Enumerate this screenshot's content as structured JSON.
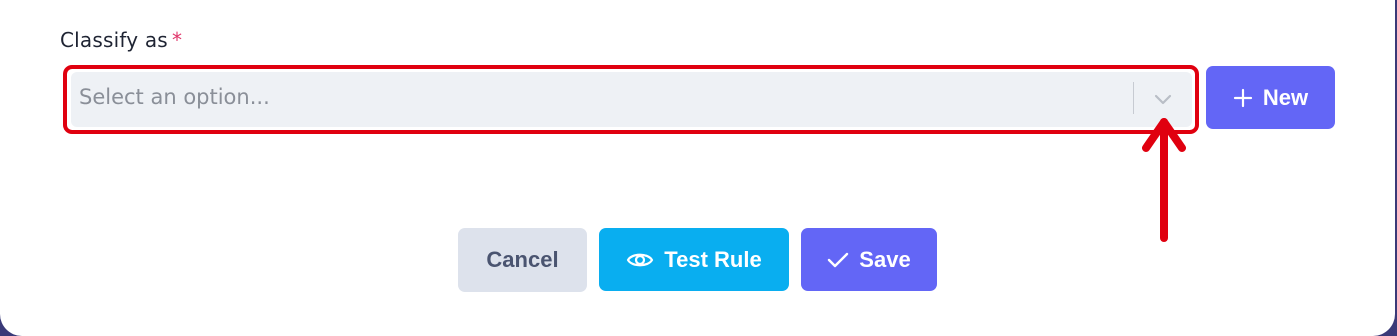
{
  "form": {
    "classify_label": "Classify as",
    "required_marker": "*",
    "select": {
      "placeholder": "Select an option...",
      "value": ""
    },
    "new_button_label": "New"
  },
  "actions": {
    "cancel_label": "Cancel",
    "test_rule_label": "Test Rule",
    "save_label": "Save"
  },
  "icons": {
    "chevron": "chevron-down-icon",
    "plus": "plus-icon",
    "eye": "eye-icon",
    "check": "check-icon"
  },
  "colors": {
    "primary": "#6366f6",
    "test_button": "#09aef0",
    "cancel_button": "#dde2ec",
    "highlight": "#e0000f",
    "required": "#e0356a",
    "select_bg": "#eef1f5"
  }
}
